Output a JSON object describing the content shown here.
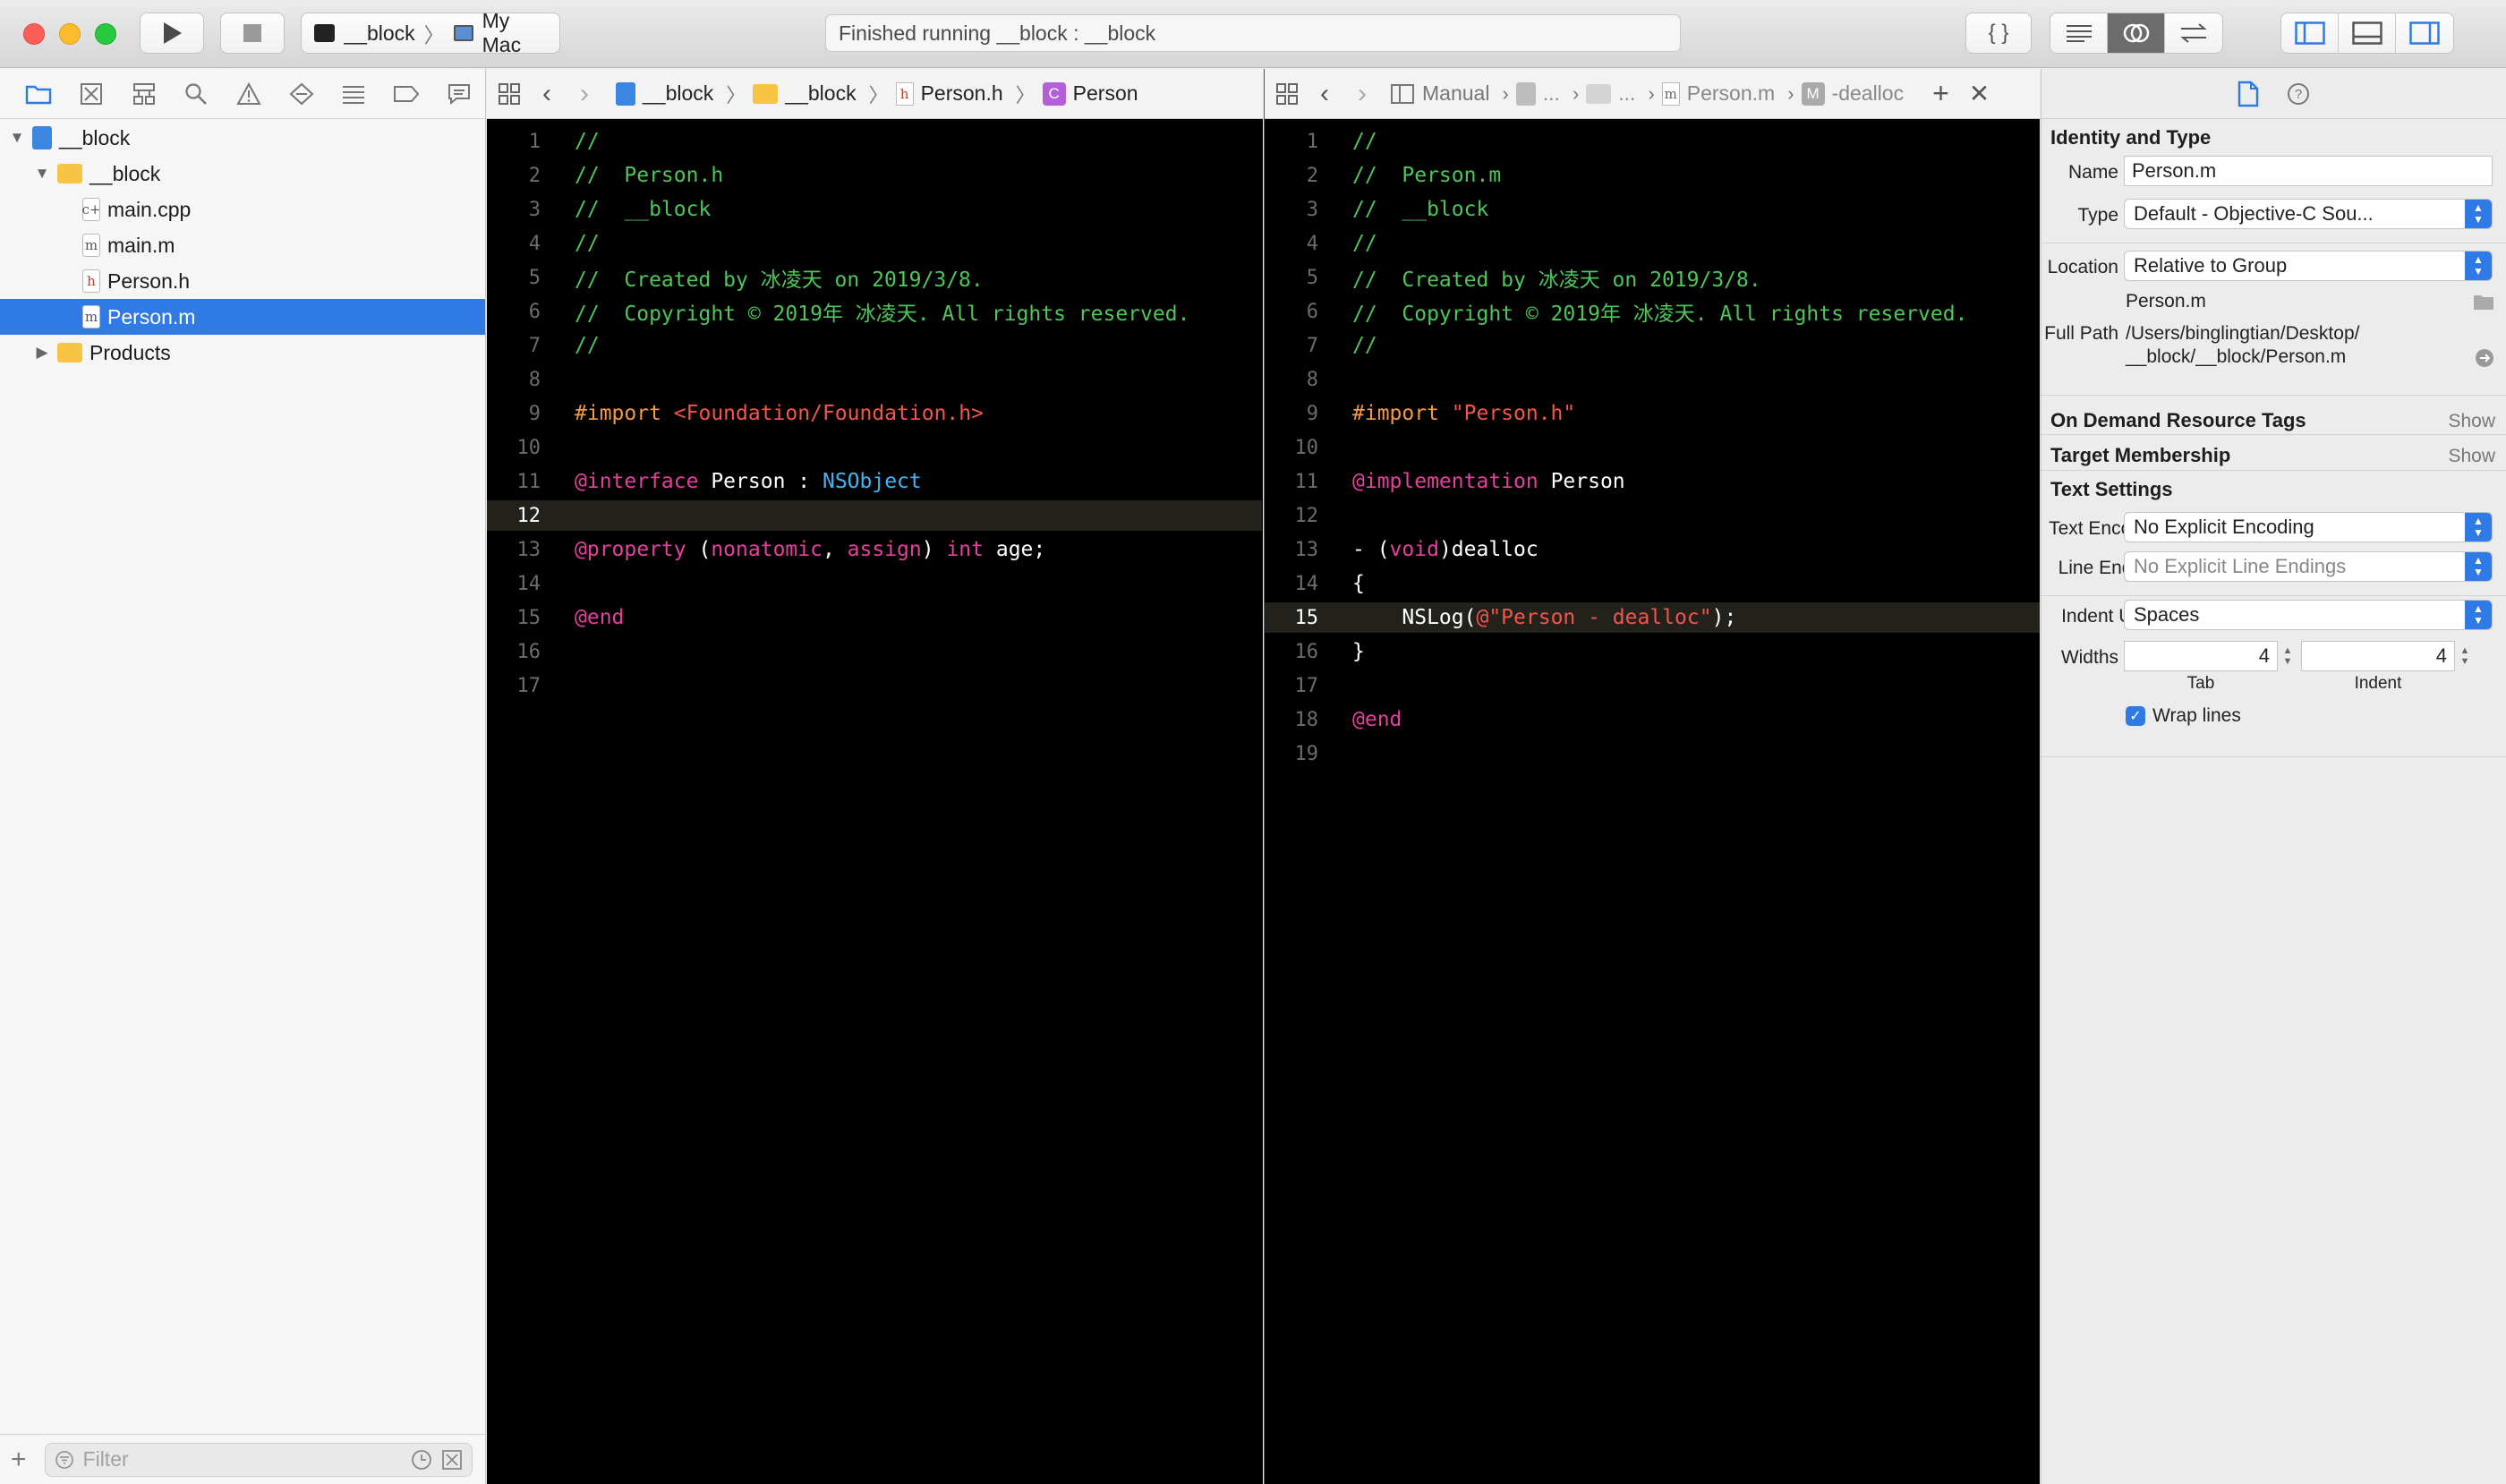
{
  "window": {
    "run_icon": "play-icon",
    "stop_icon": "stop-icon",
    "scheme": {
      "target": "__block",
      "destination": "My Mac"
    },
    "activity_status": "Finished running __block : __block",
    "library_button_label": "{ }"
  },
  "navigator": {
    "tree": [
      {
        "label": "__block",
        "icon": "project-icon",
        "level": 0,
        "expanded": true
      },
      {
        "label": "__block",
        "icon": "folder-icon",
        "level": 1,
        "expanded": true
      },
      {
        "label": "main.cpp",
        "icon": "cpp-file-icon",
        "level": 2
      },
      {
        "label": "main.m",
        "icon": "m-file-icon",
        "level": 2
      },
      {
        "label": "Person.h",
        "icon": "h-file-icon",
        "level": 2
      },
      {
        "label": "Person.m",
        "icon": "m-file-icon",
        "level": 2,
        "selected": true
      },
      {
        "label": "Products",
        "icon": "folder-icon",
        "level": 1,
        "expanded": false
      }
    ],
    "filter_placeholder": "Filter"
  },
  "left_editor": {
    "jumpbar": [
      "__block",
      "__block",
      "Person.h",
      "Person"
    ],
    "current_line": 12,
    "lines": [
      [
        {
          "t": "//",
          "c": "com"
        }
      ],
      [
        {
          "t": "//  Person.h",
          "c": "com"
        }
      ],
      [
        {
          "t": "//  __block",
          "c": "com"
        }
      ],
      [
        {
          "t": "//",
          "c": "com"
        }
      ],
      [
        {
          "t": "//  Created by 冰凌天 on 2019/3/8.",
          "c": "com"
        }
      ],
      [
        {
          "t": "//  Copyright © 2019年 冰凌天. All rights reserved.",
          "c": "com"
        }
      ],
      [
        {
          "t": "//",
          "c": "com"
        }
      ],
      [],
      [
        {
          "t": "#import ",
          "c": "pre"
        },
        {
          "t": "<Foundation/Foundation.h>",
          "c": "str"
        }
      ],
      [],
      [
        {
          "t": "@interface",
          "c": "kw"
        },
        {
          "t": " Person : ",
          "c": "plain"
        },
        {
          "t": "NSObject",
          "c": "type"
        }
      ],
      [],
      [
        {
          "t": "@property",
          "c": "kw"
        },
        {
          "t": " (",
          "c": "plain"
        },
        {
          "t": "nonatomic",
          "c": "kw"
        },
        {
          "t": ", ",
          "c": "plain"
        },
        {
          "t": "assign",
          "c": "kw"
        },
        {
          "t": ") ",
          "c": "plain"
        },
        {
          "t": "int",
          "c": "kw"
        },
        {
          "t": " age;",
          "c": "plain"
        }
      ],
      [],
      [
        {
          "t": "@end",
          "c": "kw"
        }
      ],
      [],
      []
    ]
  },
  "right_editor": {
    "jumpbar": [
      "Manual",
      "...",
      "...",
      "Person.m",
      "-dealloc"
    ],
    "current_line": 15,
    "lines": [
      [
        {
          "t": "//",
          "c": "com"
        }
      ],
      [
        {
          "t": "//  Person.m",
          "c": "com"
        }
      ],
      [
        {
          "t": "//  __block",
          "c": "com"
        }
      ],
      [
        {
          "t": "//",
          "c": "com"
        }
      ],
      [
        {
          "t": "//  Created by 冰凌天 on 2019/3/8.",
          "c": "com"
        }
      ],
      [
        {
          "t": "//  Copyright © 2019年 冰凌天. All rights reserved.",
          "c": "com"
        }
      ],
      [
        {
          "t": "//",
          "c": "com"
        }
      ],
      [],
      [
        {
          "t": "#import ",
          "c": "pre"
        },
        {
          "t": "\"Person.h\"",
          "c": "str"
        }
      ],
      [],
      [
        {
          "t": "@implementation",
          "c": "kw"
        },
        {
          "t": " Person",
          "c": "plain"
        }
      ],
      [],
      [
        {
          "t": "- (",
          "c": "plain"
        },
        {
          "t": "void",
          "c": "kw"
        },
        {
          "t": ")dealloc",
          "c": "plain"
        }
      ],
      [
        {
          "t": "{",
          "c": "plain"
        }
      ],
      [
        {
          "t": "    NSLog(",
          "c": "plain"
        },
        {
          "t": "@\"Person - dealloc\"",
          "c": "str"
        },
        {
          "t": ");",
          "c": "plain"
        }
      ],
      [
        {
          "t": "}",
          "c": "plain"
        }
      ],
      [],
      [
        {
          "t": "@end",
          "c": "kw"
        }
      ],
      []
    ]
  },
  "inspector": {
    "identity_header": "Identity and Type",
    "name_label": "Name",
    "name_value": "Person.m",
    "type_label": "Type",
    "type_value": "Default - Objective-C Sou...",
    "location_label": "Location",
    "location_value": "Relative to Group",
    "location_file": "Person.m",
    "full_path_label": "Full Path",
    "full_path_line1": "/Users/binglingtian/Desktop/",
    "full_path_line2": "__block/__block/Person.m",
    "odr_header": "On Demand Resource Tags",
    "odr_show": "Show",
    "target_header": "Target Membership",
    "target_show": "Show",
    "text_settings_header": "Text Settings",
    "encoding_label": "Text Encoding",
    "encoding_value": "No Explicit Encoding",
    "line_endings_label": "Line Endings",
    "line_endings_value": "No Explicit Line Endings",
    "indent_using_label": "Indent Using",
    "indent_using_value": "Spaces",
    "widths_label": "Widths",
    "tab_width": "4",
    "indent_width": "4",
    "tab_caption": "Tab",
    "indent_caption": "Indent",
    "wrap_lines_label": "Wrap lines",
    "wrap_lines_checked": true
  },
  "colors": {
    "comment": "#4ec65a",
    "keyword": "#e3419c",
    "preprocessor": "#f39a47",
    "string": "#f2564b",
    "type": "#42b4f0",
    "selection": "#2f7ae5"
  }
}
